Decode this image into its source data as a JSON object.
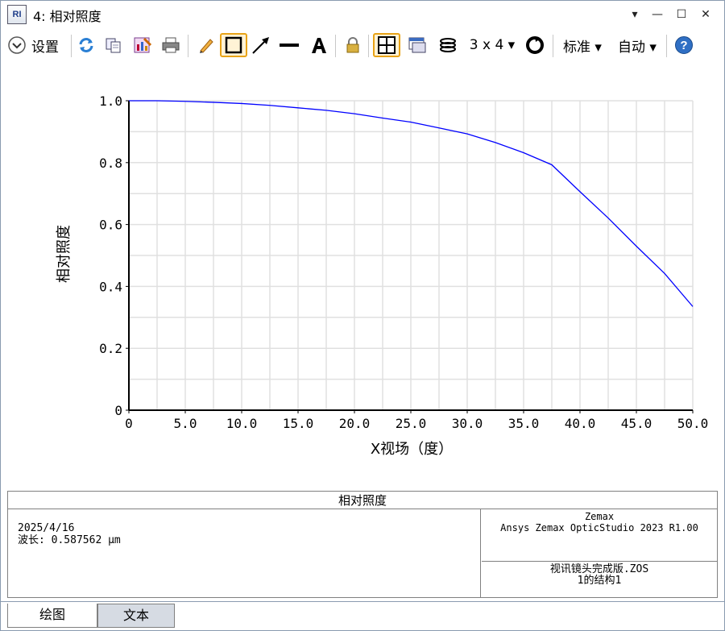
{
  "window": {
    "title": "4: 相对照度",
    "app_icon_text": "RI",
    "controls": {
      "dropdown": "▾",
      "minimize": "—",
      "maximize": "☐",
      "close": "✕"
    }
  },
  "toolbar": {
    "settings_label": "设置",
    "layout_label": "3 x 4 ▾",
    "standard_label": "标准 ▾",
    "auto_label": "自动 ▾",
    "icons": [
      "settings-chevron-icon",
      "refresh-icon",
      "copy-icon",
      "export-icon",
      "print-icon",
      "pencil-icon",
      "rectangle-icon",
      "arrow-line-icon",
      "line-icon",
      "text-icon",
      "lock-icon",
      "grid-layout-icon",
      "window-icon",
      "layers-icon",
      "rotate-icon",
      "help-icon"
    ]
  },
  "colors": {
    "line": "#0000ff",
    "grid": "#e0e0e0",
    "axis": "#000000",
    "active_tool": "#e8a317"
  },
  "chart_data": {
    "type": "line",
    "title": "",
    "xlabel": "X视场（度）",
    "ylabel": "相对照度",
    "xlim": [
      0,
      50
    ],
    "ylim": [
      0,
      1.0
    ],
    "x_ticks": [
      "0",
      "5.0",
      "10.0",
      "15.0",
      "20.0",
      "25.0",
      "30.0",
      "35.0",
      "40.0",
      "45.0",
      "50.0"
    ],
    "y_ticks": [
      "0",
      "0.2",
      "0.4",
      "0.6",
      "0.8",
      "1.0"
    ],
    "grid": true,
    "series": [
      {
        "x": [
          0,
          2.5,
          5,
          7.5,
          10,
          12.5,
          15,
          17.5,
          20,
          22.5,
          25,
          27.5,
          30,
          32.5,
          35,
          37.5,
          40,
          42.5,
          45,
          47.5,
          50
        ],
        "y": [
          1.0,
          1.0,
          0.998,
          0.995,
          0.991,
          0.985,
          0.977,
          0.969,
          0.958,
          0.944,
          0.931,
          0.912,
          0.893,
          0.865,
          0.832,
          0.793,
          0.706,
          0.621,
          0.53,
          0.442,
          0.335
        ]
      }
    ]
  },
  "info_panel": {
    "title": "相对照度",
    "date": "2025/4/16",
    "wavelength": "波长: 0.587562 μm",
    "company": "Zemax",
    "product": "Ansys Zemax OpticStudio 2023 R1.00",
    "file": "视讯镜头完成版.ZOS",
    "config": "1的结构1"
  },
  "tabs": [
    {
      "label": "绘图"
    },
    {
      "label": "文本"
    }
  ]
}
